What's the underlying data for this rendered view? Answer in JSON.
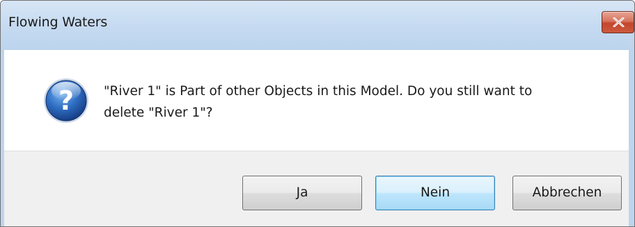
{
  "window": {
    "title": "Flowing Waters"
  },
  "titlebar": {
    "close_icon": "close-x-icon"
  },
  "dialog": {
    "icon": "question-icon",
    "message_line1": "\"River 1\" is Part of other Objects in this Model. Do you still want to",
    "message_line2": "delete \"River 1\"?"
  },
  "buttons": {
    "yes_accelerator": "J",
    "yes_rest": "a",
    "no_label": "Nein",
    "cancel_label": "Abbrechen"
  },
  "colors": {
    "titlebar": "#c6dbf1",
    "close_button": "#c4452c",
    "default_button_border": "#3c7fb1",
    "footer": "#f0f0f0"
  }
}
